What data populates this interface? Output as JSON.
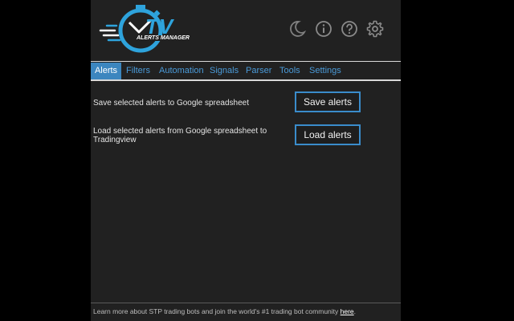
{
  "header": {
    "logo_text_big": "TV",
    "logo_text_small": "ALERTS MANAGER",
    "icons": [
      "moon-icon",
      "info-icon",
      "help-icon",
      "gear-icon"
    ]
  },
  "tabs": [
    {
      "label": "Alerts",
      "active": true
    },
    {
      "label": "Filters",
      "active": false
    },
    {
      "label": "Automation",
      "active": false
    },
    {
      "label": "Signals",
      "active": false
    },
    {
      "label": "Parser",
      "active": false
    },
    {
      "label": "Tools",
      "active": false
    },
    {
      "label": "Settings",
      "active": false
    }
  ],
  "main": {
    "save_text": "Save selected alerts to Google spreadsheet",
    "save_button": "Save alerts",
    "load_text": "Load selected alerts from Google spreadsheet to Tradingview",
    "load_button": "Load alerts"
  },
  "footer": {
    "text": "Learn more about STP trading bots and join the world's #1 trading bot community ",
    "link": "here",
    "suffix": "."
  },
  "colors": {
    "background": "#212121",
    "accent": "#3a8ccb",
    "tab_text": "#4a9ad8",
    "logo_blue": "#2ea3dc"
  }
}
